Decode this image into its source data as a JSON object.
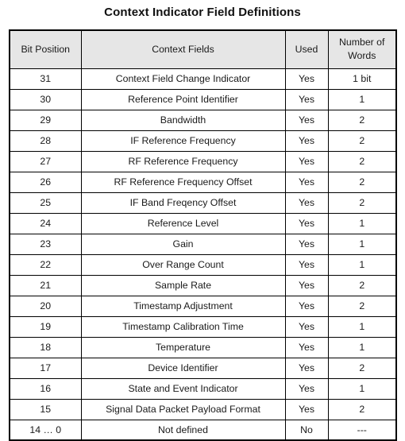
{
  "document": {
    "title": "Context Indicator Field Definitions"
  },
  "table": {
    "columns": [
      "Bit Position",
      "Context Fields",
      "Used",
      "Number of Words"
    ],
    "header_colors": {
      "background": "#e6e6e6",
      "border": "#000000"
    },
    "rows": [
      {
        "bit": "31",
        "field": "Context Field Change Indicator",
        "used": "Yes",
        "words": "1 bit"
      },
      {
        "bit": "30",
        "field": "Reference Point Identifier",
        "used": "Yes",
        "words": "1"
      },
      {
        "bit": "29",
        "field": "Bandwidth",
        "used": "Yes",
        "words": "2"
      },
      {
        "bit": "28",
        "field": "IF Reference Frequency",
        "used": "Yes",
        "words": "2"
      },
      {
        "bit": "27",
        "field": "RF Reference Frequency",
        "used": "Yes",
        "words": "2"
      },
      {
        "bit": "26",
        "field": "RF Reference Frequency Offset",
        "used": "Yes",
        "words": "2"
      },
      {
        "bit": "25",
        "field": "IF Band Freqency Offset",
        "used": "Yes",
        "words": "2"
      },
      {
        "bit": "24",
        "field": "Reference Level",
        "used": "Yes",
        "words": "1"
      },
      {
        "bit": "23",
        "field": "Gain",
        "used": "Yes",
        "words": "1"
      },
      {
        "bit": "22",
        "field": "Over Range Count",
        "used": "Yes",
        "words": "1"
      },
      {
        "bit": "21",
        "field": "Sample Rate",
        "used": "Yes",
        "words": "2"
      },
      {
        "bit": "20",
        "field": "Timestamp Adjustment",
        "used": "Yes",
        "words": "2"
      },
      {
        "bit": "19",
        "field": "Timestamp Calibration Time",
        "used": "Yes",
        "words": "1"
      },
      {
        "bit": "18",
        "field": "Temperature",
        "used": "Yes",
        "words": "1"
      },
      {
        "bit": "17",
        "field": "Device Identifier",
        "used": "Yes",
        "words": "2"
      },
      {
        "bit": "16",
        "field": "State and Event Indicator",
        "used": "Yes",
        "words": "1"
      },
      {
        "bit": "15",
        "field": "Signal Data Packet Payload Format",
        "used": "Yes",
        "words": "2"
      },
      {
        "bit": "14 … 0",
        "field": "Not defined",
        "used": "No",
        "words": "---"
      }
    ]
  }
}
